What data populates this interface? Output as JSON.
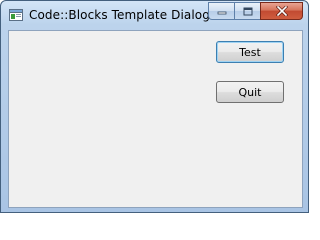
{
  "window": {
    "title": "Code::Blocks Template Dialog...",
    "app_icon": "dialog-window-icon",
    "caption_buttons": [
      {
        "name": "minimize",
        "icon": "minimize-icon"
      },
      {
        "name": "maximize",
        "icon": "maximize-icon"
      },
      {
        "name": "close",
        "icon": "close-icon"
      }
    ]
  },
  "dialog": {
    "test_label": "Test",
    "quit_label": "Quit"
  },
  "colors": {
    "title_bar": "#bcd3ec",
    "client_background": "#f0f0f0",
    "close_button": "#c24a31",
    "focused_button_border": "#3c7fb1"
  }
}
